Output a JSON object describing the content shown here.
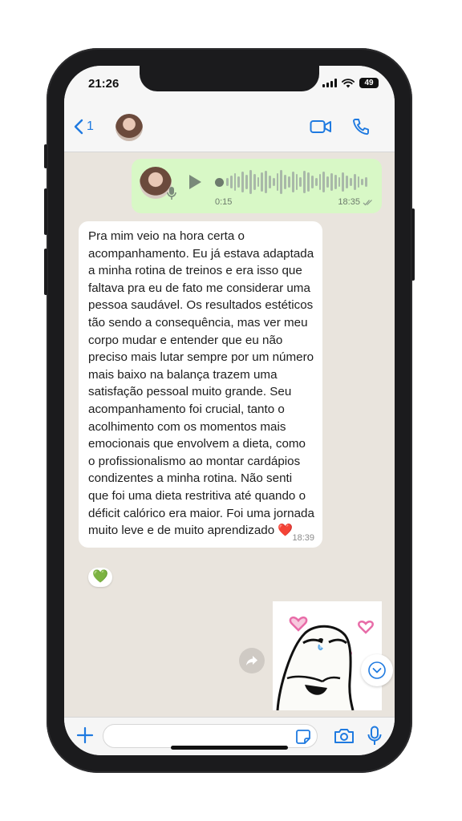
{
  "status_bar": {
    "time": "21:26",
    "battery": "49"
  },
  "header": {
    "back_count": "1"
  },
  "chat": {
    "voice_message": {
      "duration": "0:15",
      "time": "18:35"
    },
    "text_message": {
      "text": "Pra mim veio na hora certa o acompanhamento. Eu já estava adaptada a minha rotina de treinos e era isso que faltava pra eu de fato me considerar uma pessoa saudável. Os resultados estéticos tão sendo a consequência, mas ver meu corpo mudar e entender que eu não preciso mais lutar sempre por um número mais baixo na balança trazem uma satisfação pessoal muito grande. Seu acompanhamento foi crucial, tanto o acolhimento com os momentos mais emocionais que envolvem a dieta, como o profissionalismo ao montar cardápios condizentes a minha rotina. Não senti que foi uma dieta restritiva até quando o déficit calórico era maior. Foi uma jornada muito leve e de muito aprendizado ❤️",
      "time": "18:39",
      "reaction": "💚"
    }
  },
  "composer": {
    "value": "",
    "placeholder": ""
  },
  "colors": {
    "accent": "#1f7ae0",
    "outgoing_bubble": "#d8f8c6",
    "incoming_bubble": "#ffffff",
    "chat_background": "#e9e4dd"
  },
  "icons": [
    "back-chevron-icon",
    "video-call-icon",
    "phone-icon",
    "play-icon",
    "mic-icon",
    "forward-icon",
    "chevron-down-icon",
    "plus-icon",
    "sticker-icon",
    "camera-icon",
    "microphone-icon"
  ]
}
